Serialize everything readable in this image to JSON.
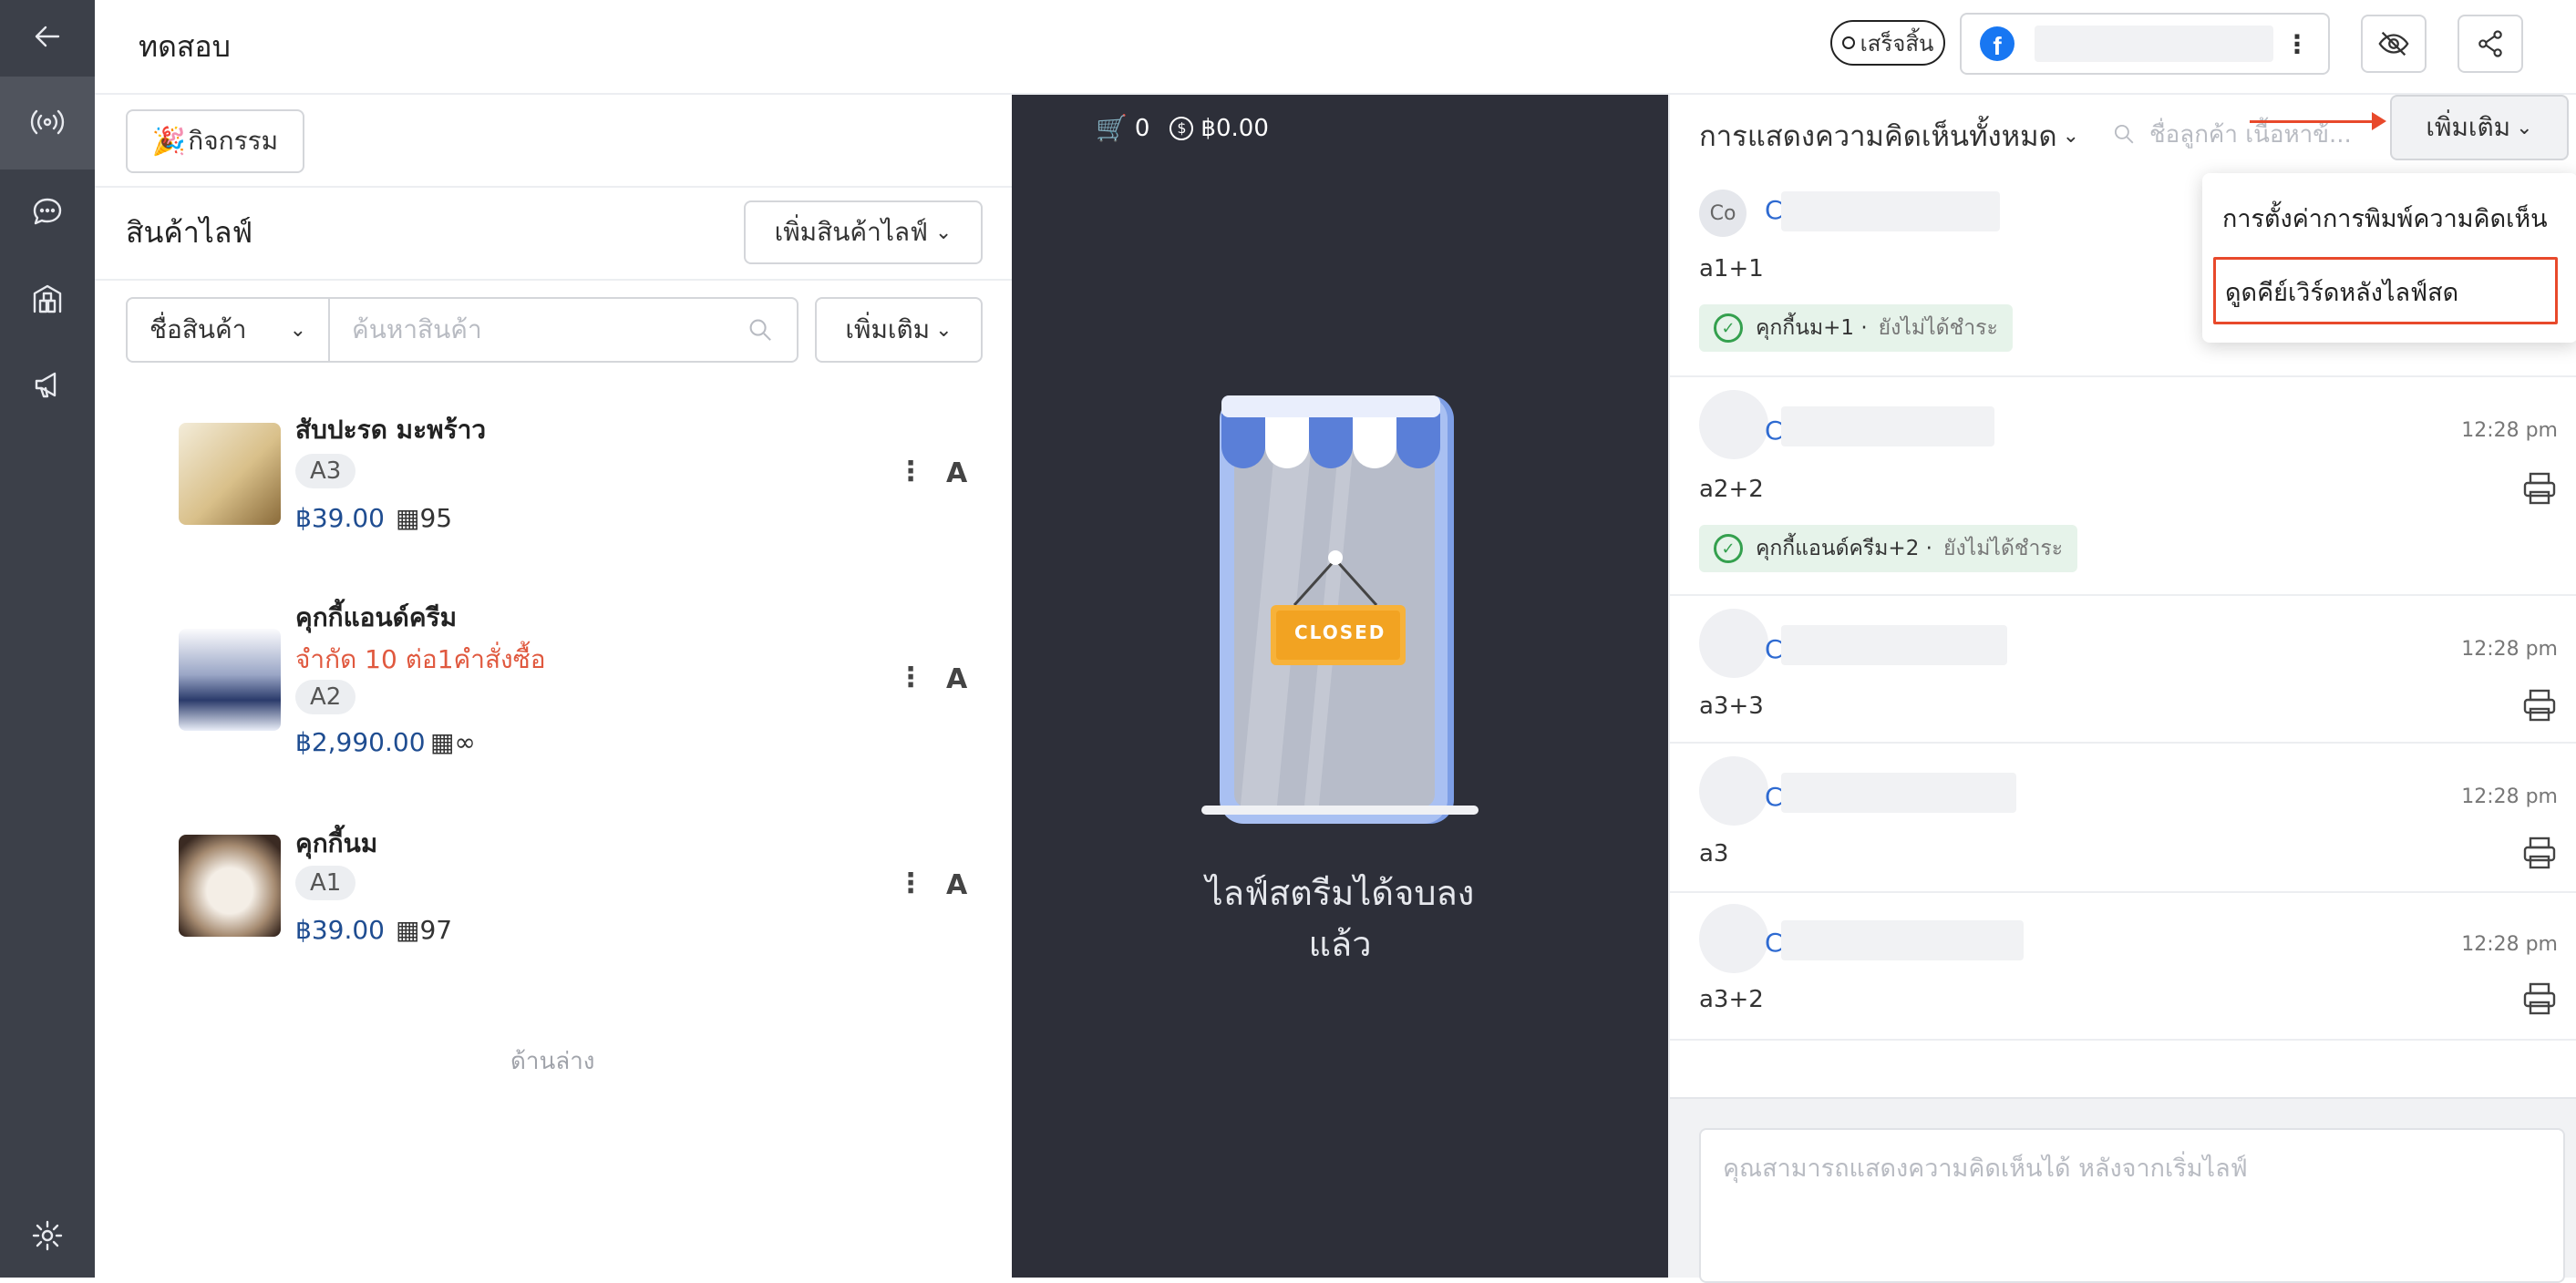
{
  "header": {
    "title": "ทดสอบ",
    "status_label": "เสร็จสิ้น",
    "more_icon": "kebab-icon"
  },
  "left": {
    "activity_button": "กิจกรรม",
    "live_products_title": "สินค้าไลฟ์",
    "add_live_product": "เพิ่มสินค้าไลฟ์",
    "filter_select": "ชื่อสินค้า",
    "search_placeholder": "ค้นหาสินค้า",
    "more_button": "เพิ่มเติม",
    "products": [
      {
        "name": "สับปะรด มะพร้าว",
        "limit": "",
        "code": "A3",
        "price": "฿39.00",
        "stock": "95",
        "right_letter": "A"
      },
      {
        "name": "คุกกี้แอนด์ครีม",
        "limit": "จำกัด 10 ต่อ1คำสั่งซื้อ",
        "code": "A2",
        "price": "฿2,990.00",
        "stock": "∞",
        "right_letter": "A"
      },
      {
        "name": "คุกกี้นม",
        "limit": "",
        "code": "A1",
        "price": "฿39.00",
        "stock": "97",
        "right_letter": "A"
      }
    ],
    "bottom_label": "ด้านล่าง"
  },
  "middle": {
    "cart_count": "0",
    "amount": "฿0.00",
    "sign_text": "CLOSED",
    "ended_line1": "ไลฟ์สตรีมได้จบลง",
    "ended_line2": "แล้ว"
  },
  "right": {
    "filter_label": "การแสดงความคิดเห็นทั้งหมด",
    "search_placeholder": "ชื่อลูกค้า เนื้อหาข้...",
    "more_button": "เพิ่มเติม",
    "dropdown": [
      "การตั้งค่าการพิมพ์ความคิดเห็น",
      "ดูดคีย์เวิร์ดหลังไลฟ์สด"
    ],
    "comments": [
      {
        "avatar": "Co",
        "name": "C",
        "time": "",
        "text": "a1+1",
        "chip": "คุกกี้นม+1 ·",
        "chip_status": "ยังไม่ได้ชำระ"
      },
      {
        "avatar": "",
        "name": "C",
        "time": "12:28 pm",
        "text": "a2+2",
        "chip": "คุกกี้แอนด์ครีม+2 ·",
        "chip_status": "ยังไม่ได้ชำระ"
      },
      {
        "avatar": "",
        "name": "C",
        "time": "12:28 pm",
        "text": "a3+3",
        "chip": "",
        "chip_status": ""
      },
      {
        "avatar": "",
        "name": "C",
        "time": "12:28 pm",
        "text": "a3",
        "chip": "",
        "chip_status": ""
      },
      {
        "avatar": "",
        "name": "C",
        "time": "12:28 pm",
        "text": "a3+2",
        "chip": "",
        "chip_status": ""
      }
    ],
    "composer_placeholder": "คุณสามารถแสดงความคิดเห็นได้ หลังจากเริ่มไลฟ์"
  },
  "colors": {
    "sidebar": "#3c4049",
    "stream_bg": "#2d2f39",
    "accent_blue": "#2e6ad1",
    "price_blue": "#1f4d91",
    "limit_red": "#e0593f",
    "highlight_red": "#e8492b",
    "chip_green": "#e6f3ea"
  }
}
